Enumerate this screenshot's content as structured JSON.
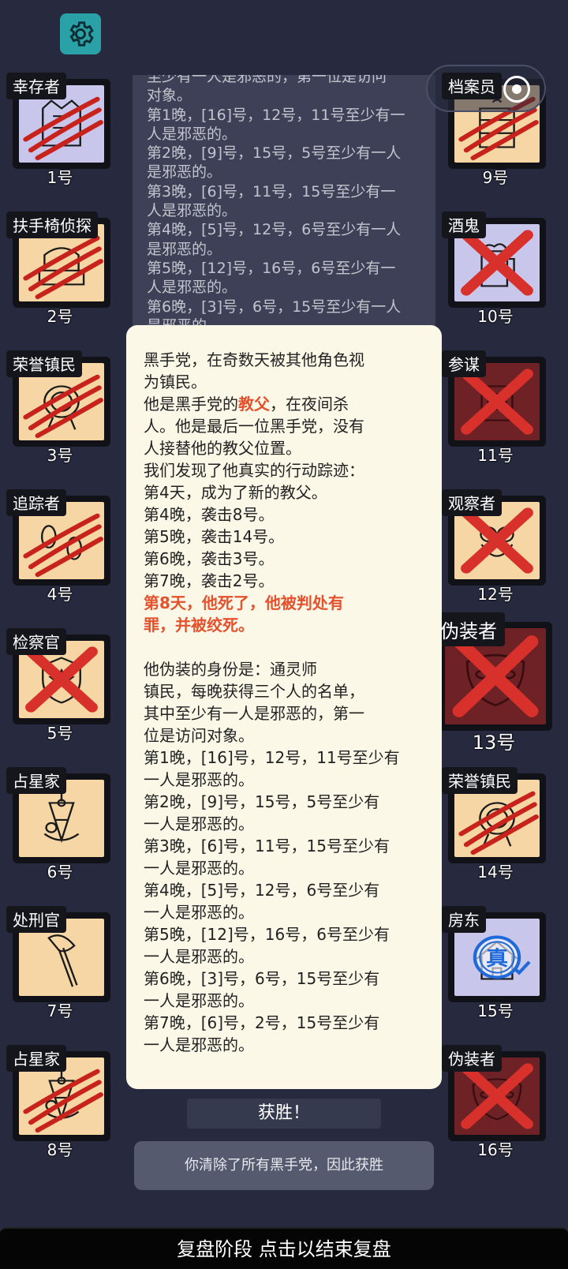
{
  "header": {
    "settings_icon": "gear-icon"
  },
  "capsule": {
    "dots": "•••",
    "partial_label": "档案员"
  },
  "players": [
    {
      "label": "幸存者",
      "num": "1号",
      "bg": "lav",
      "icon": "vest-icon",
      "mark": "claw"
    },
    {
      "label": "扶手椅侦探",
      "num": "2号",
      "bg": "tan",
      "icon": "armchair-icon",
      "mark": "claw"
    },
    {
      "label": "荣誉镇民",
      "num": "3号",
      "bg": "tan",
      "icon": "medal-icon",
      "mark": "claw"
    },
    {
      "label": "追踪者",
      "num": "4号",
      "bg": "tan",
      "icon": "footprint-icon",
      "mark": "claw"
    },
    {
      "label": "检察官",
      "num": "5号",
      "bg": "tan",
      "icon": "badge-icon",
      "mark": "cross"
    },
    {
      "label": "占星家",
      "num": "6号",
      "bg": "tan",
      "icon": "sextant-icon",
      "mark": "none"
    },
    {
      "label": "处刑官",
      "num": "7号",
      "bg": "tan",
      "icon": "axe-icon",
      "mark": "none"
    },
    {
      "label": "占星家",
      "num": "8号",
      "bg": "tan",
      "icon": "sextant-icon",
      "mark": "claw"
    },
    {
      "label": "档案员",
      "num": "9号",
      "bg": "tan",
      "icon": "archive-icon",
      "mark": "claw"
    },
    {
      "label": "酒鬼",
      "num": "10号",
      "bg": "lav",
      "icon": "beer-icon",
      "mark": "cross"
    },
    {
      "label": "参谋",
      "num": "11号",
      "bg": "maroon",
      "icon": "scroll-icon",
      "mark": "cross"
    },
    {
      "label": "观察者",
      "num": "12号",
      "bg": "tan",
      "icon": "owl-icon",
      "mark": "cross"
    },
    {
      "label": "伪装者",
      "num": "13号",
      "bg": "maroon",
      "icon": "mask-icon",
      "mark": "cross"
    },
    {
      "label": "荣誉镇民",
      "num": "14号",
      "bg": "tan",
      "icon": "medal-icon",
      "mark": "claw"
    },
    {
      "label": "房东",
      "num": "15号",
      "bg": "lav",
      "icon": "house-icon",
      "mark": "stamp",
      "stamp": "真"
    },
    {
      "label": "伪装者",
      "num": "16号",
      "bg": "maroon",
      "icon": "mask-icon",
      "mark": "cross"
    }
  ],
  "background_log": [
    "至少有一人是邪恶的，第一位是访问",
    "对象。",
    "第1晚，[16]号，12号，11号至少有一",
    "人是邪恶的。",
    "第2晚，[9]号，15号，5号至少有一人",
    "是邪恶的。",
    "第3晚，[6]号，11号，15号至少有一",
    "人是邪恶的。",
    "第4晚，[5]号，12号，6号至少有一人",
    "是邪恶的。",
    "第5晚，[12]号，16号，6号至少有一",
    "人是邪恶的。",
    "第6晚，[3]号，6号，15号至少有一人",
    "是邪恶的。"
  ],
  "modal": {
    "intro_1": "黑手党，在奇数天被其他角色视",
    "intro_2": "为镇民。",
    "role_pre": "他是黑手党的",
    "role_name": "教父",
    "role_post": "，在夜间杀",
    "role_2": "人。他是最后一位黑手党，没有",
    "role_3": "人接替他的教父位置。",
    "trace_title": "我们发现了他真实的行动踪迹：",
    "trace": [
      "第4天，成为了新的教父。",
      "第4晚，袭击8号。",
      "第5晚，袭击14号。",
      "第6晚，袭击3号。",
      "第7晚，袭击2号。"
    ],
    "death_1": "第8天，他死了，他被判处有",
    "death_2": "罪，并被绞死。",
    "disguise_title": "他伪装的身份是：通灵师",
    "disguise_lines": [
      "镇民，每晚获得三个人的名单，",
      "其中至少有一人是邪恶的，第一",
      "位是访问对象。",
      "第1晚，[16]号，12号，11号至少有",
      "一人是邪恶的。",
      "第2晚，[9]号，15号，5号至少有",
      "一人是邪恶的。",
      "第3晚，[6]号，11号，15号至少有",
      "一人是邪恶的。",
      "第4晚，[5]号，12号，6号至少有",
      "一人是邪恶的。",
      "第5晚，[12]号，16号，6号至少有",
      "一人是邪恶的。",
      "第6晚，[3]号，6号，15号至少有",
      "一人是邪恶的。",
      "第7晚，[6]号，2号，15号至少有",
      "一人是邪恶的。"
    ]
  },
  "result": {
    "win_label": "获胜！",
    "reason": "你清除了所有黑手党，因此获胜"
  },
  "footer": {
    "text": "复盘阶段 点击以结束复盘"
  },
  "colors": {
    "accent_red": "#e4512d",
    "bg": "#272a3e",
    "tan": "#f5d6a4",
    "lavender": "#c9c6ec",
    "maroon": "#6e2226"
  }
}
